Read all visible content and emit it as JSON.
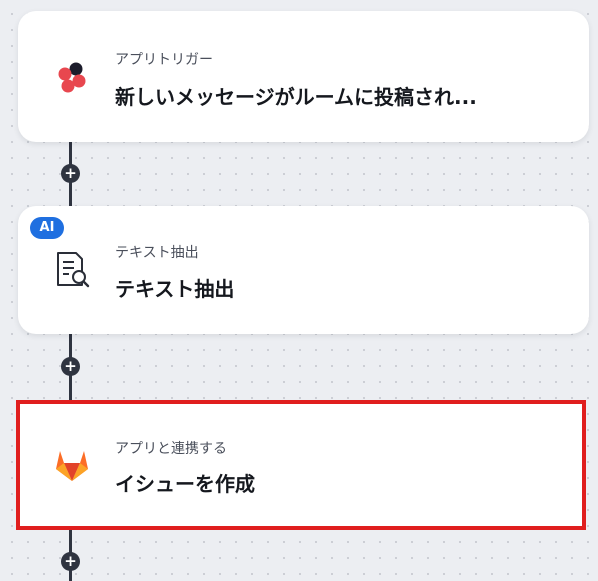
{
  "steps": [
    {
      "subtitle": "アプリトリガー",
      "title": "新しいメッセージがルームに投稿され...",
      "icon": "chatwork-icon"
    },
    {
      "subtitle": "テキスト抽出",
      "title": "テキスト抽出",
      "icon": "document-search-icon",
      "badge": "AI"
    },
    {
      "subtitle": "アプリと連携する",
      "title": "イシューを作成",
      "icon": "gitlab-icon",
      "selected": true
    }
  ],
  "add_step_symbol": "+",
  "colors": {
    "selected_border": "#e01e1e",
    "ai_badge": "#1f6fe0",
    "connector": "#2f3440"
  }
}
